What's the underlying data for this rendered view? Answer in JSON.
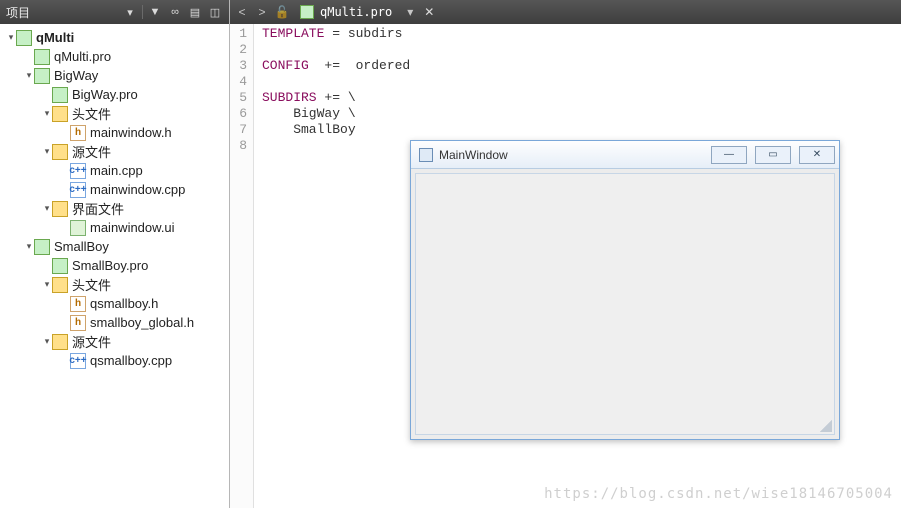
{
  "sidebar": {
    "title": "项目",
    "header_icons": [
      "dropdown",
      "filter",
      "link",
      "split-h",
      "split-v"
    ],
    "tree": [
      {
        "indent": 0,
        "arrow": "▾",
        "icon": "qt",
        "label": "qMulti",
        "bold": true
      },
      {
        "indent": 1,
        "arrow": "",
        "icon": "qt",
        "label": "qMulti.pro"
      },
      {
        "indent": 1,
        "arrow": "▾",
        "icon": "qt",
        "label": "BigWay"
      },
      {
        "indent": 2,
        "arrow": "",
        "icon": "qt",
        "label": "BigWay.pro"
      },
      {
        "indent": 2,
        "arrow": "▾",
        "icon": "folder",
        "label": "头文件"
      },
      {
        "indent": 3,
        "arrow": "",
        "icon": "h",
        "label": "mainwindow.h"
      },
      {
        "indent": 2,
        "arrow": "▾",
        "icon": "folder",
        "label": "源文件"
      },
      {
        "indent": 3,
        "arrow": "",
        "icon": "cpp",
        "label": "main.cpp"
      },
      {
        "indent": 3,
        "arrow": "",
        "icon": "cpp",
        "label": "mainwindow.cpp"
      },
      {
        "indent": 2,
        "arrow": "▾",
        "icon": "folder",
        "label": "界面文件"
      },
      {
        "indent": 3,
        "arrow": "",
        "icon": "ui",
        "label": "mainwindow.ui"
      },
      {
        "indent": 1,
        "arrow": "▾",
        "icon": "qt",
        "label": "SmallBoy"
      },
      {
        "indent": 2,
        "arrow": "",
        "icon": "qt",
        "label": "SmallBoy.pro"
      },
      {
        "indent": 2,
        "arrow": "▾",
        "icon": "folder",
        "label": "头文件"
      },
      {
        "indent": 3,
        "arrow": "",
        "icon": "h",
        "label": "qsmallboy.h"
      },
      {
        "indent": 3,
        "arrow": "",
        "icon": "h",
        "label": "smallboy_global.h"
      },
      {
        "indent": 2,
        "arrow": "▾",
        "icon": "folder",
        "label": "源文件"
      },
      {
        "indent": 3,
        "arrow": "",
        "icon": "cpp",
        "label": "qsmallboy.cpp"
      }
    ]
  },
  "editor": {
    "tab": {
      "filename": "qMulti.pro"
    },
    "lines": [
      {
        "n": 1,
        "tokens": [
          [
            "kw",
            "TEMPLATE"
          ],
          [
            "op",
            " = "
          ],
          [
            "id",
            "subdirs"
          ]
        ]
      },
      {
        "n": 2,
        "tokens": []
      },
      {
        "n": 3,
        "tokens": [
          [
            "kw",
            "CONFIG"
          ],
          [
            "op",
            "  +=  "
          ],
          [
            "id",
            "ordered"
          ]
        ]
      },
      {
        "n": 4,
        "tokens": []
      },
      {
        "n": 5,
        "tokens": [
          [
            "kw",
            "SUBDIRS"
          ],
          [
            "op",
            " += \\"
          ]
        ]
      },
      {
        "n": 6,
        "tokens": [
          [
            "id",
            "    BigWay \\"
          ]
        ]
      },
      {
        "n": 7,
        "tokens": [
          [
            "id",
            "    SmallBoy"
          ]
        ]
      },
      {
        "n": 8,
        "tokens": []
      }
    ]
  },
  "appwindow": {
    "title": "MainWindow",
    "buttons": {
      "min": "—",
      "max": "▭",
      "close": "✕"
    }
  },
  "watermark": "https://blog.csdn.net/wise18146705004"
}
